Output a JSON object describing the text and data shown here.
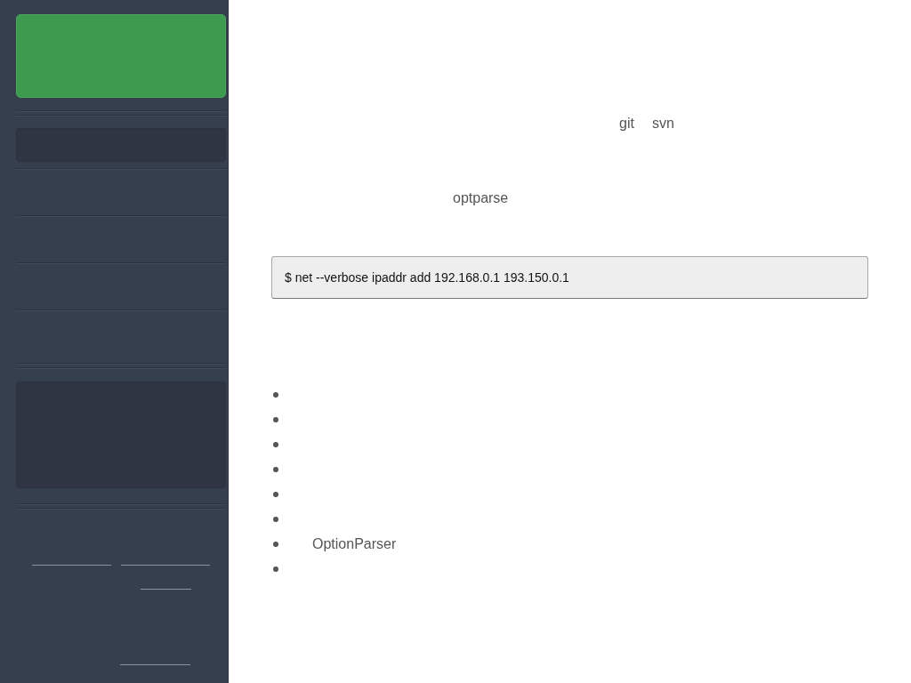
{
  "inline_terms": [
    {
      "text": "git"
    },
    {
      "text": "svn"
    }
  ],
  "paragraph_term": "optparse",
  "code_block": "$ net --verbose ipaddr add 192.168.0.1 193.150.0.1",
  "bullet_list": [
    {
      "kind": "blank"
    },
    {
      "kind": "blank"
    },
    {
      "kind": "blank"
    },
    {
      "kind": "blank"
    },
    {
      "kind": "blank"
    },
    {
      "kind": "blank"
    },
    {
      "kind": "text",
      "text": "OptionParser"
    },
    {
      "kind": "blank"
    }
  ]
}
